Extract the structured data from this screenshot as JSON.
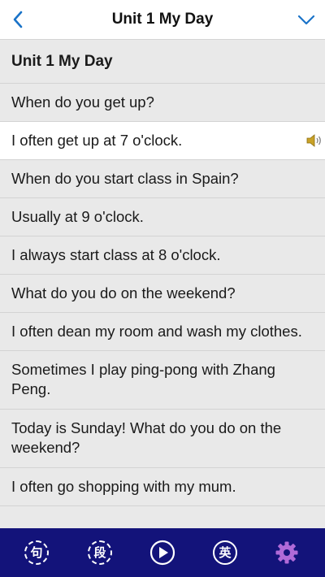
{
  "header": {
    "title": "Unit 1 My Day",
    "back_icon": "chevron-left-icon",
    "dropdown_icon": "chevron-down-icon",
    "accent": "#1a73c8"
  },
  "list": {
    "heading": "Unit 1 My Day",
    "items": [
      "When do you get up?",
      "I often get up at 7 o'clock.",
      "When do you start class in Spain?",
      "Usually at 9 o'clock.",
      "I always start class at 8 o'clock.",
      "What do you do on the weekend?",
      "I often dean my room and wash my clothes.",
      "Sometimes I play ping-pong with Zhang Peng.",
      "Today is Sunday! What do you do on the weekend?",
      "I often go shopping with my mum."
    ],
    "active_index": 1,
    "speaker_icon": "speaker-icon"
  },
  "bottom_bar": {
    "background": "#13137a",
    "sentence_btn": "句",
    "paragraph_btn": "段",
    "english_btn": "英",
    "play_icon": "play-icon",
    "settings_icon": "gear-icon"
  }
}
